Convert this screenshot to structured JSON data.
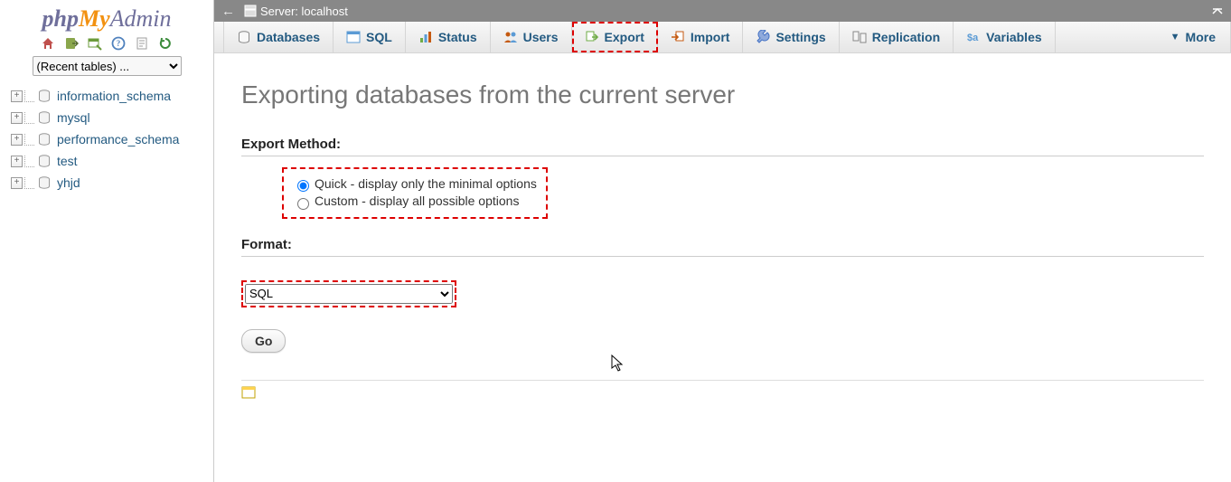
{
  "logo": {
    "part1": "php",
    "part2": "My",
    "part3": "Admin"
  },
  "sidebar": {
    "recent_tables_label": "(Recent tables) ...",
    "databases": [
      {
        "name": "information_schema"
      },
      {
        "name": "mysql"
      },
      {
        "name": "performance_schema"
      },
      {
        "name": "test"
      },
      {
        "name": "yhjd"
      }
    ]
  },
  "topbar": {
    "server_label": "Server: localhost"
  },
  "tabs": [
    {
      "label": "Databases",
      "icon": "db"
    },
    {
      "label": "SQL",
      "icon": "sql"
    },
    {
      "label": "Status",
      "icon": "status"
    },
    {
      "label": "Users",
      "icon": "users"
    },
    {
      "label": "Export",
      "icon": "export",
      "highlight": true
    },
    {
      "label": "Import",
      "icon": "import"
    },
    {
      "label": "Settings",
      "icon": "settings"
    },
    {
      "label": "Replication",
      "icon": "replication"
    },
    {
      "label": "Variables",
      "icon": "variables"
    }
  ],
  "more_label": "More",
  "page": {
    "title": "Exporting databases from the current server",
    "export_method_label": "Export Method:",
    "radio_quick": "Quick - display only the minimal options",
    "radio_custom": "Custom - display all possible options",
    "format_label": "Format:",
    "format_value": "SQL",
    "go_label": "Go"
  }
}
